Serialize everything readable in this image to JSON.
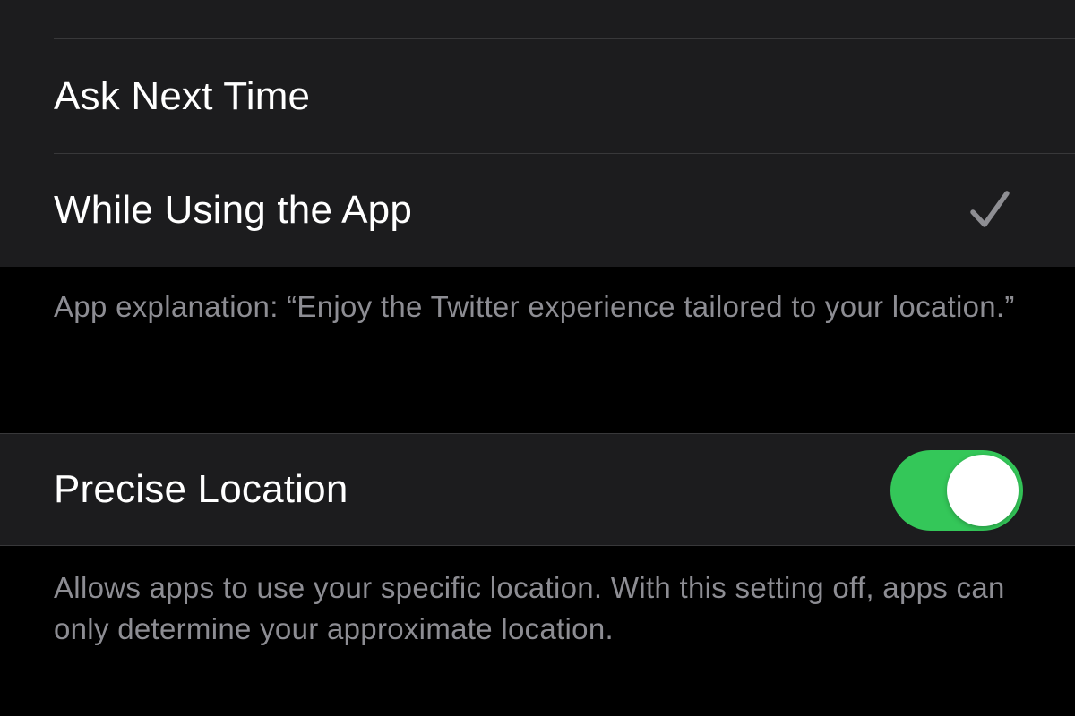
{
  "location_access": {
    "options": [
      {
        "label": "Ask Next Time",
        "selected": false
      },
      {
        "label": "While Using the App",
        "selected": true
      }
    ],
    "app_explanation": "App explanation: “Enjoy the Twitter experience tailored to your location.”"
  },
  "precise_location": {
    "label": "Precise Location",
    "enabled": true,
    "footnote": "Allows apps to use your specific location. With this setting off, apps can only determine your approximate location."
  },
  "icons": {
    "selected_option": "checkmark-icon"
  },
  "colors": {
    "background": "#000000",
    "group_background": "#1c1c1e",
    "separator": "#38383a",
    "toggle_on": "#34c759",
    "secondary_text": "#8d8d93",
    "checkmark": "#8e8e93"
  }
}
